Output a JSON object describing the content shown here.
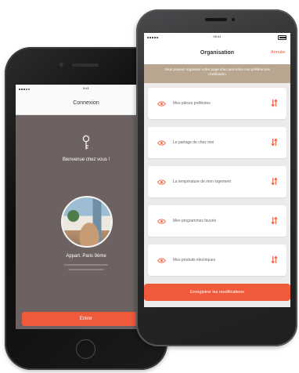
{
  "colors": {
    "accent": "#ef5a3a",
    "left_screen_bg": "#6d6161",
    "banner_bg": "#b9a691",
    "list_bg": "#ecebea"
  },
  "left_phone": {
    "status_time": "9:41",
    "title": "Connexion",
    "welcome_icon": "key-icon",
    "welcome": "Bienvenue chez vous !",
    "home_name": "Appart. Paris 9ème",
    "enter_label": "Entrer"
  },
  "right_phone": {
    "status_time": "09:41",
    "title": "Organisation",
    "cancel_label": "Annuler",
    "banner": "Vous pouvez organiser votre page d'accueil selon vos préférences d'utilisation",
    "items": [
      {
        "label": "Mes pièces préférées",
        "icon": "eye-icon",
        "handle": "reorder-arrows-icon"
      },
      {
        "label": "Le partage de chez moi",
        "icon": "eye-icon",
        "handle": "reorder-arrows-icon"
      },
      {
        "label": "La température de mon logement",
        "icon": "eye-icon",
        "handle": "reorder-arrows-icon"
      },
      {
        "label": "Mes programmes favoris",
        "icon": "eye-icon",
        "handle": "reorder-arrows-icon"
      },
      {
        "label": "Mes produits électriques",
        "icon": "eye-icon",
        "handle": "reorder-arrows-icon"
      }
    ],
    "save_label": "Enregistrer les modifications"
  }
}
